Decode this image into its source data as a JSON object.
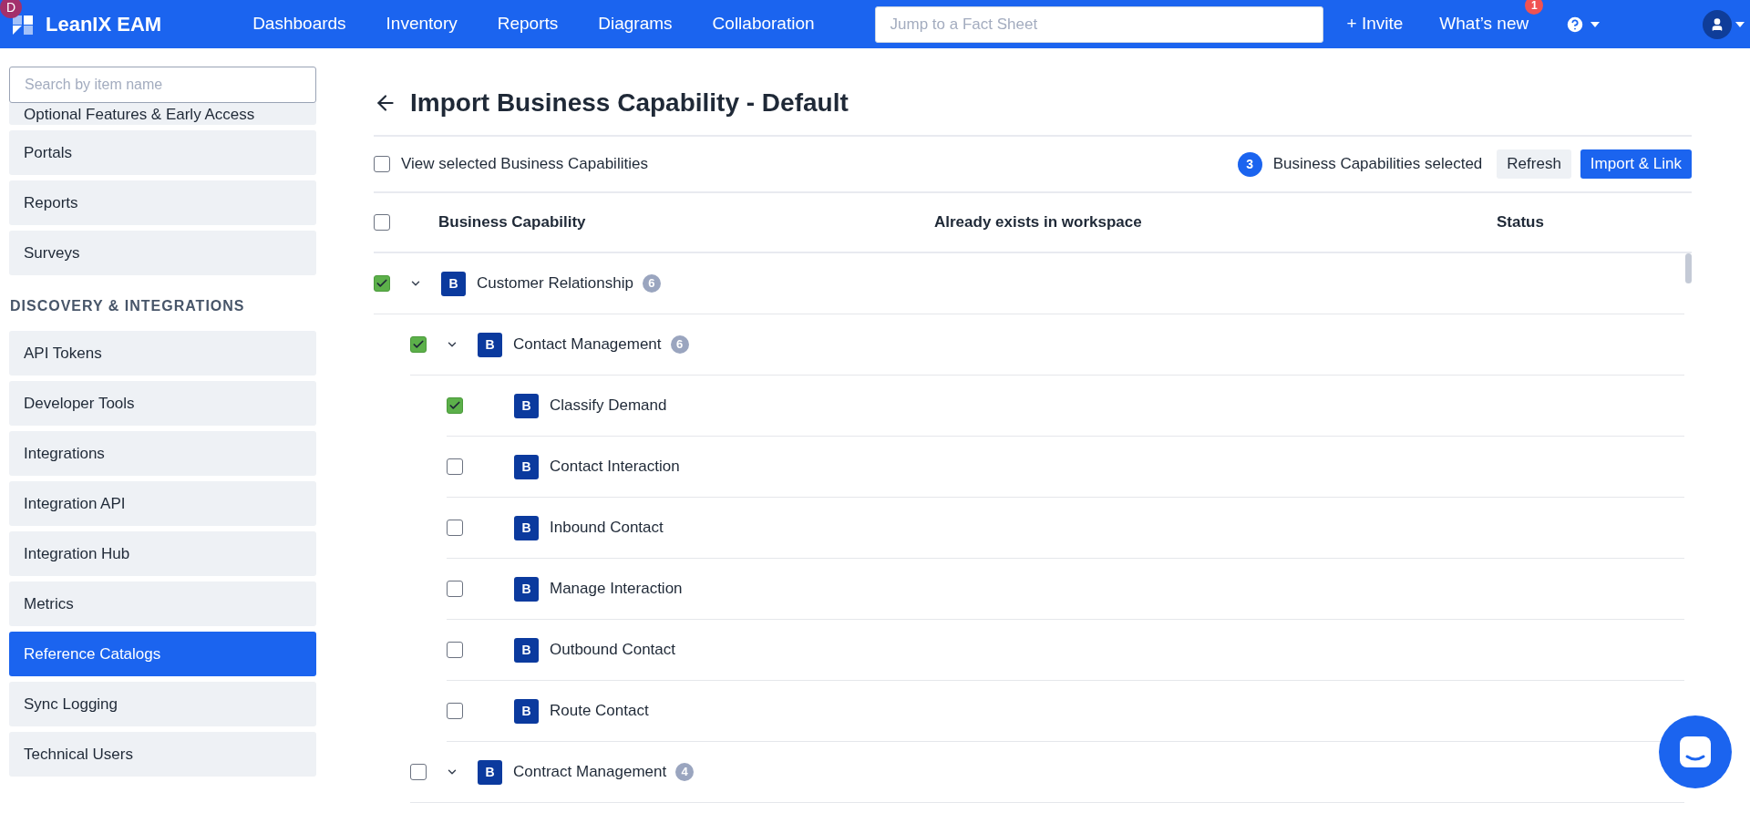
{
  "topbar": {
    "logo_badge": "D",
    "brand": "LeanIX EAM",
    "nav": [
      {
        "label": "Dashboards"
      },
      {
        "label": "Inventory"
      },
      {
        "label": "Reports"
      },
      {
        "label": "Diagrams"
      },
      {
        "label": "Collaboration"
      }
    ],
    "search": {
      "placeholder": "Jump to a Fact Sheet"
    },
    "invite": "+ Invite",
    "whats_new": {
      "label": "What’s new",
      "badge": "1"
    }
  },
  "sidebar": {
    "search": {
      "placeholder": "Search by item name"
    },
    "groups": [
      {
        "items": [
          {
            "label": "Optional Features & Early Access",
            "selected": false
          },
          {
            "label": "Portals",
            "selected": false
          },
          {
            "label": "Reports",
            "selected": false
          },
          {
            "label": "Surveys",
            "selected": false
          }
        ]
      },
      {
        "heading": "DISCOVERY & INTEGRATIONS",
        "items": [
          {
            "label": "API Tokens",
            "selected": false
          },
          {
            "label": "Developer Tools",
            "selected": false
          },
          {
            "label": "Integrations",
            "selected": false
          },
          {
            "label": "Integration API",
            "selected": false
          },
          {
            "label": "Integration Hub",
            "selected": false
          },
          {
            "label": "Metrics",
            "selected": false
          },
          {
            "label": "Reference Catalogs",
            "selected": true
          },
          {
            "label": "Sync Logging",
            "selected": false
          },
          {
            "label": "Technical Users",
            "selected": false
          }
        ]
      }
    ]
  },
  "page": {
    "title": "Import Business Capability - Default",
    "view_selected": {
      "label": "View selected Business Capabilities",
      "checked": false
    },
    "selected_count": "3",
    "selected_label": "Business Capabilities selected",
    "buttons": [
      {
        "label": "Refresh",
        "kind": "secondary"
      },
      {
        "label": "Import & Link",
        "kind": "primary"
      }
    ]
  },
  "table": {
    "select_all": {
      "checked": false
    },
    "columns": [
      "Business Capability",
      "Already exists in workspace",
      "Status"
    ],
    "rows": [
      {
        "type": "B",
        "name": "Customer Relationship",
        "count": "6",
        "checked": true,
        "expanded": true,
        "children": [
          {
            "type": "B",
            "name": "Contact Management",
            "count": "6",
            "checked": true,
            "expanded": true,
            "children": [
              {
                "type": "B",
                "name": "Classify Demand",
                "checked": true
              },
              {
                "type": "B",
                "name": "Contact Interaction",
                "checked": false
              },
              {
                "type": "B",
                "name": "Inbound Contact",
                "checked": false
              },
              {
                "type": "B",
                "name": "Manage Interaction",
                "checked": false
              },
              {
                "type": "B",
                "name": "Outbound Contact",
                "checked": false
              },
              {
                "type": "B",
                "name": "Route Contact",
                "checked": false
              }
            ]
          },
          {
            "type": "B",
            "name": "Contract Management",
            "count": "4",
            "checked": false,
            "expanded": true
          }
        ]
      }
    ]
  }
}
